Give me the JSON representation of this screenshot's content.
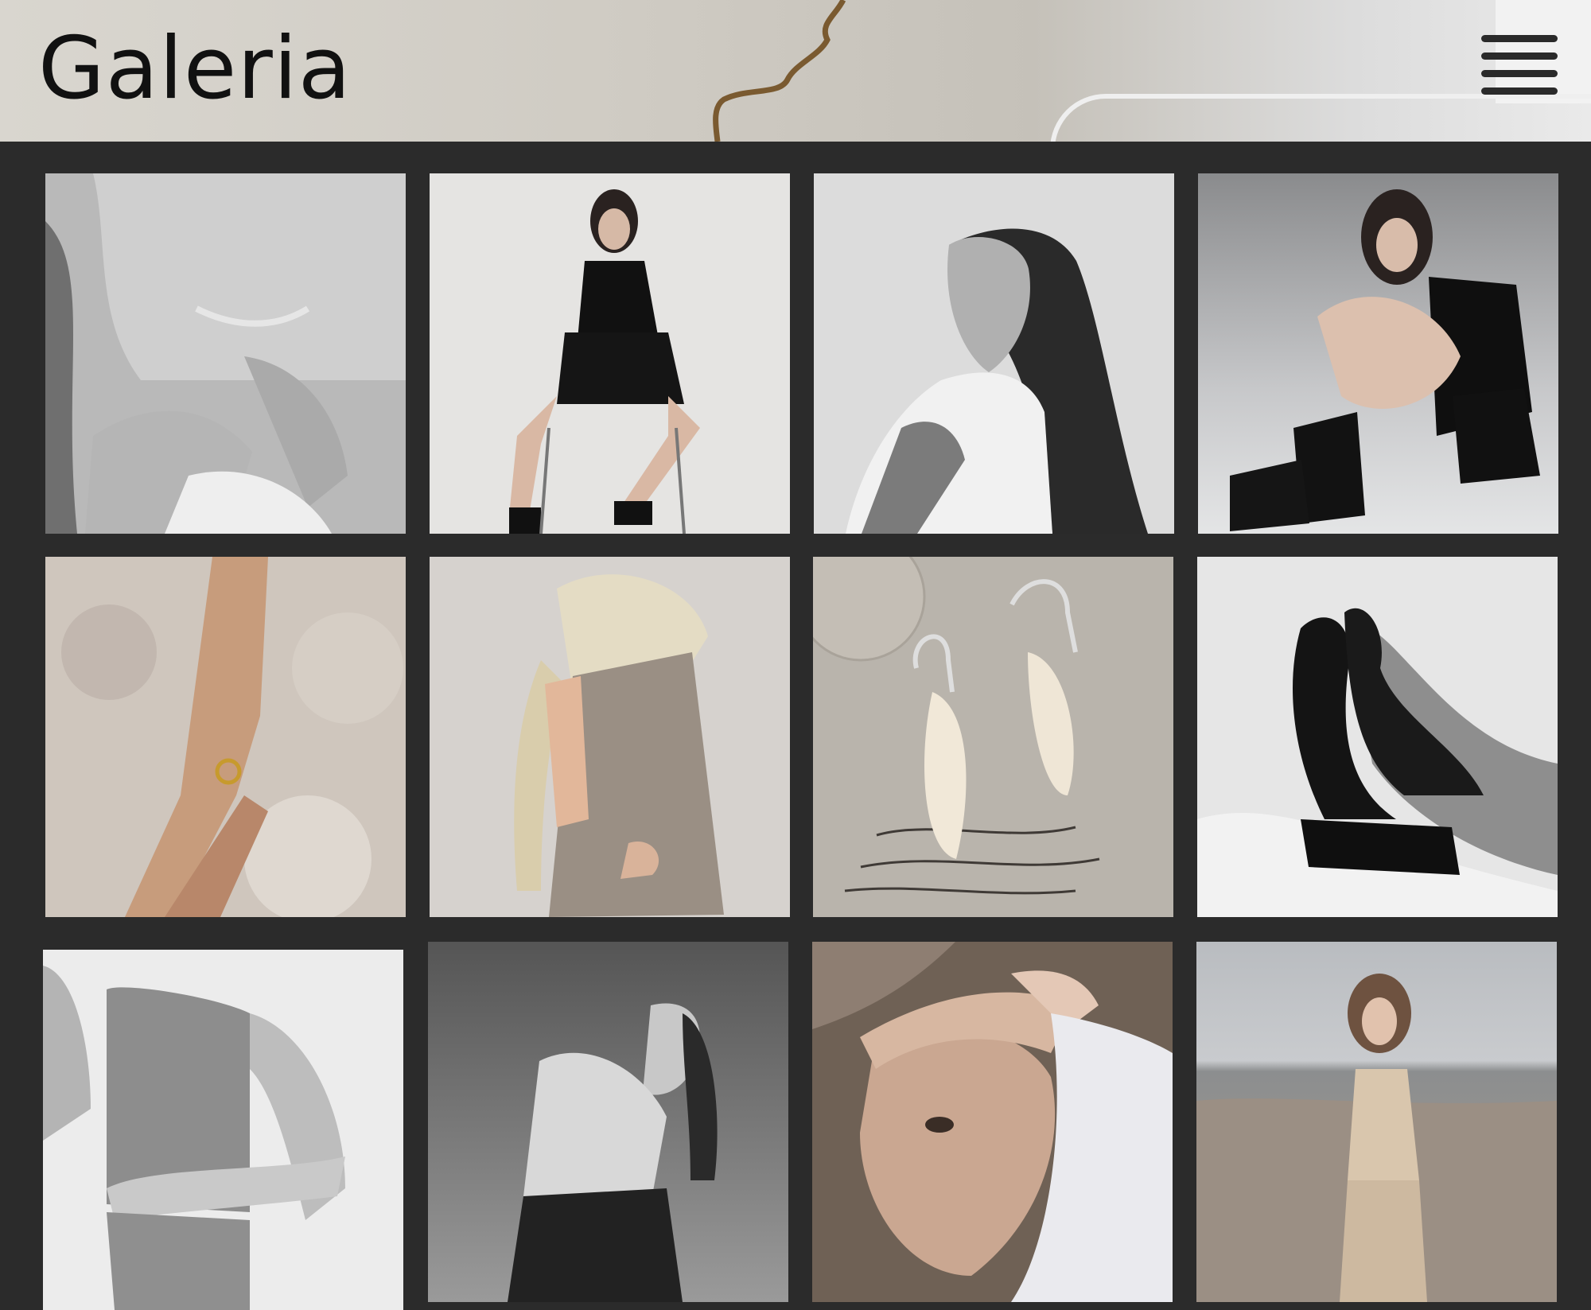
{
  "header": {
    "title": "Galeria"
  },
  "icons": {
    "menu": "hamburger-menu-icon"
  },
  "colors": {
    "page_background": "#2b2b2b",
    "title_text": "#111111"
  },
  "gallery": {
    "photos": [
      {
        "subject": "neck-with-necklace-bw"
      },
      {
        "subject": "woman-seated-on-chair"
      },
      {
        "subject": "woman-head-tilted-back-bw"
      },
      {
        "subject": "woman-sitting-hugging-knees"
      },
      {
        "subject": "hand-with-gold-ring-in-foam"
      },
      {
        "subject": "blonde-braid-open-back-blazer"
      },
      {
        "subject": "pearl-earrings-on-handwritten-letter"
      },
      {
        "subject": "legs-in-black-heels-bw"
      },
      {
        "subject": "torso-in-tank-top-bw"
      },
      {
        "subject": "woman-leaning-back-bw"
      },
      {
        "subject": "woman-face-with-hand-on-head"
      },
      {
        "subject": "woman-on-beach"
      }
    ]
  }
}
